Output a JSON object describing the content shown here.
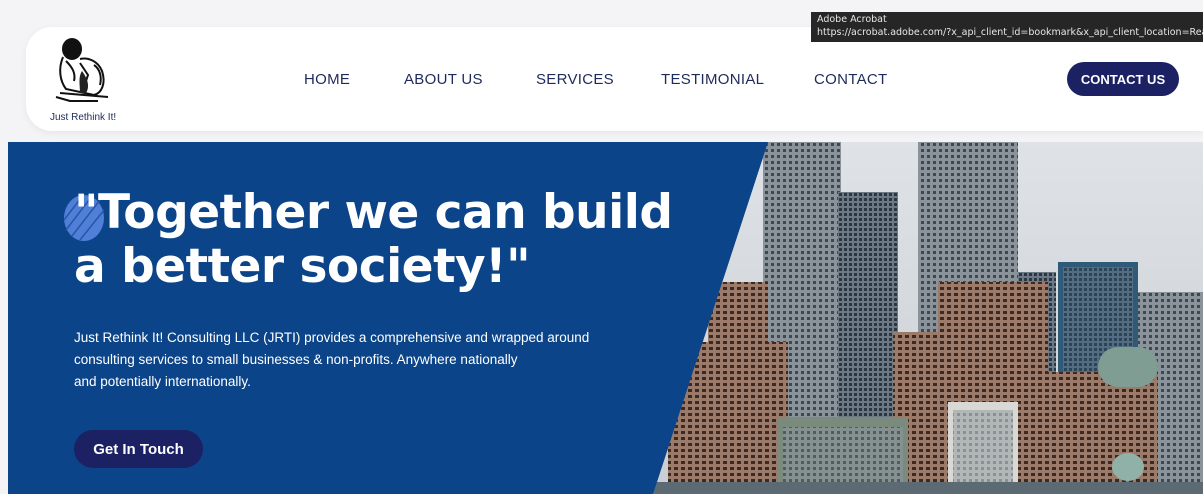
{
  "tooltip": {
    "title": "Adobe Acrobat",
    "url": "https://acrobat.adobe.com/?x_api_client_id=bookmark&x_api_client_location=Rea"
  },
  "logo": {
    "text": "Just Rethink It!"
  },
  "nav": {
    "items": [
      {
        "label": "HOME"
      },
      {
        "label": "ABOUT US"
      },
      {
        "label": "SERVICES"
      },
      {
        "label": "TESTIMONIAL"
      },
      {
        "label": "CONTACT"
      }
    ],
    "cta_label": "CONTACT US"
  },
  "hero": {
    "title_line1": "\"Together we can build",
    "title_line2": "a better society!\"",
    "desc_line1": "Just Rethink It! Consulting LLC (JRTI) provides a comprehensive and wrapped around",
    "desc_line2": "consulting services to small businesses & non-profits. Anywhere nationally",
    "desc_line3": "and potentially internationally.",
    "button_label": "Get In Touch"
  },
  "colors": {
    "hero_bg": "#0b4488",
    "brand_navy": "#1b2163",
    "nav_text": "#1e2a5a"
  }
}
